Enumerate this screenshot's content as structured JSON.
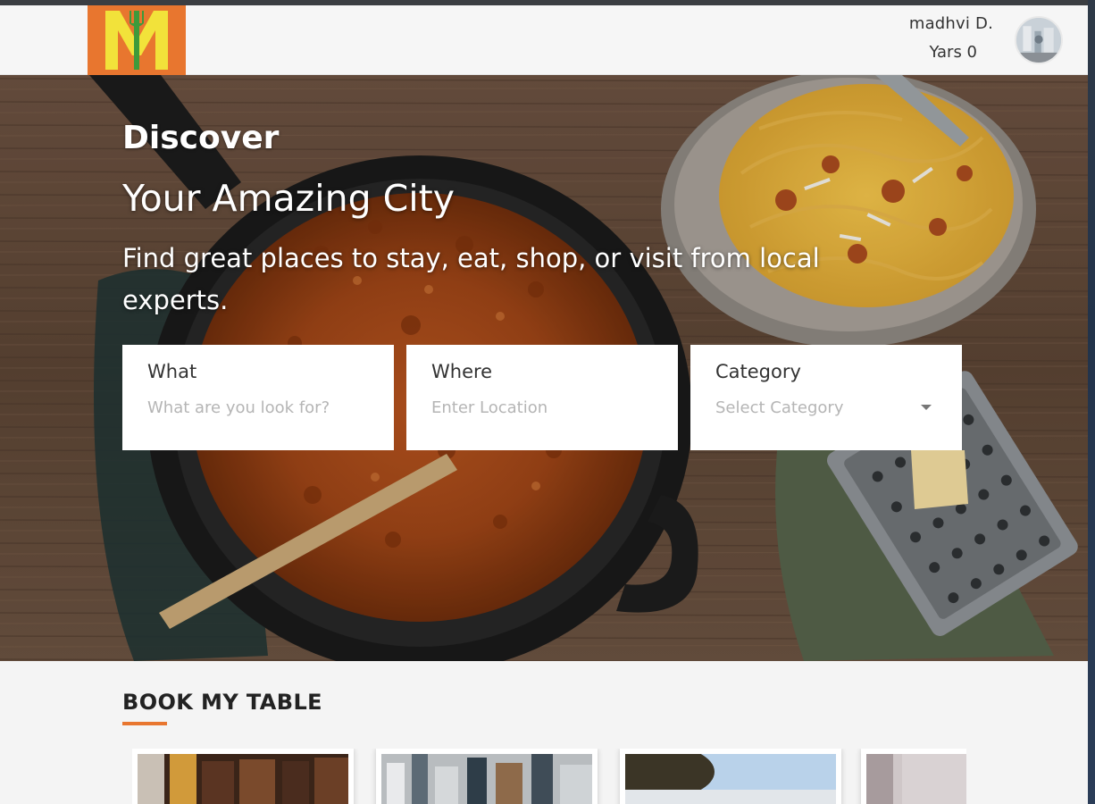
{
  "header": {
    "logo_text": "M",
    "user": {
      "name": "madhvi D.",
      "subtitle": "Yars 0"
    }
  },
  "hero": {
    "title": "Discover",
    "subtitle": "Your Amazing City",
    "description": "Find great places to stay, eat, shop, or visit from local experts."
  },
  "search": {
    "what": {
      "label": "What",
      "placeholder": "What are you look for?"
    },
    "where": {
      "label": "Where",
      "placeholder": "Enter Location"
    },
    "category": {
      "label": "Category",
      "selected": "Select Category"
    }
  },
  "section": {
    "title": "BOOK MY TABLE"
  },
  "colors": {
    "accent": "#e8762f",
    "logo_letter": "#f2e23a"
  }
}
